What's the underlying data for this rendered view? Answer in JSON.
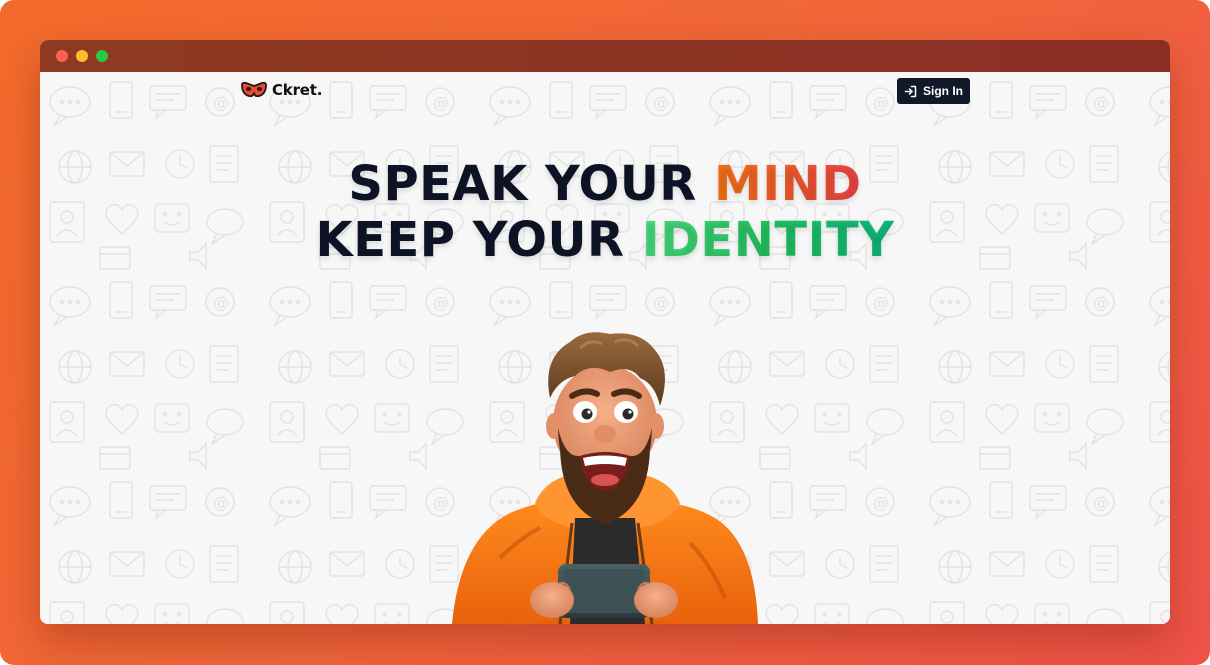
{
  "brand": {
    "name": "Ckret.",
    "logo_icon": "mask-icon",
    "logo_color": "#ef4a2e"
  },
  "nav": {
    "signin_label": "Sign In",
    "signin_icon": "sign-in-icon",
    "signin_bg": "#111827"
  },
  "hero": {
    "line1_prefix": "SPEAK YOUR ",
    "line1_accent": "MIND",
    "line2_prefix": "KEEP YOUR ",
    "line2_accent": "IDENTITY",
    "accent_mind_colors": [
      "#f97316",
      "#ef4444"
    ],
    "accent_identity_colors": [
      "#4ade80",
      "#10b981"
    ],
    "illustration": "cartoon-man-with-phone"
  },
  "colors": {
    "frame_gradient": [
      "#f26b2a",
      "#ef5249"
    ],
    "titlebar": "#8e3a22",
    "page_bg": "#f7f7f7",
    "headline": "#0d1224"
  }
}
